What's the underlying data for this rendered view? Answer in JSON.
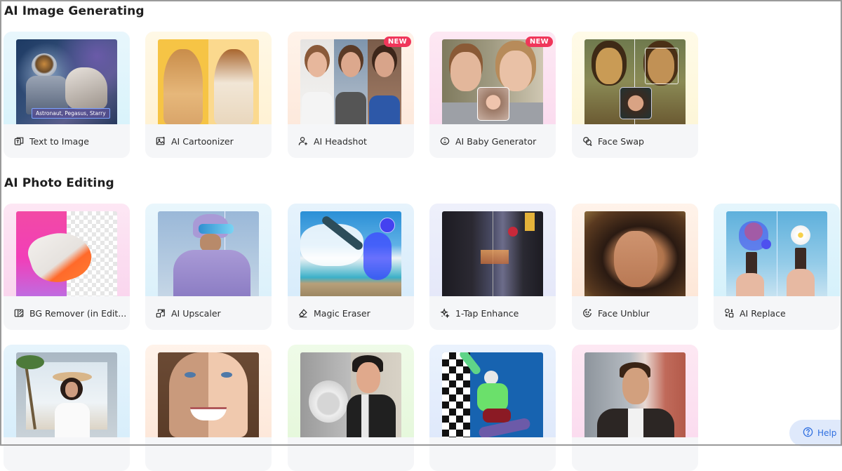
{
  "sections": [
    {
      "title": "AI Image Generating",
      "cards": [
        {
          "label": "Text to Image",
          "icon": "text-to-image-icon",
          "caption": "Astronaut, Pegasus, Starry"
        },
        {
          "label": "AI Cartoonizer",
          "icon": "image-sparkle-icon"
        },
        {
          "label": "AI Headshot",
          "icon": "user-plus-icon",
          "badge": "NEW"
        },
        {
          "label": "AI Baby Generator",
          "icon": "baby-face-icon",
          "badge": "NEW"
        },
        {
          "label": "Face Swap",
          "icon": "face-swap-icon"
        }
      ]
    },
    {
      "title": "AI Photo Editing",
      "cards": [
        {
          "label": "BG Remover (in Edit...",
          "icon": "bg-remover-icon"
        },
        {
          "label": "AI Upscaler",
          "icon": "upscale-icon"
        },
        {
          "label": "Magic Eraser",
          "icon": "eraser-icon"
        },
        {
          "label": "1-Tap Enhance",
          "icon": "enhance-sparkle-icon"
        },
        {
          "label": "Face Unblur",
          "icon": "smile-face-icon"
        },
        {
          "label": "AI Replace",
          "icon": "replace-icon"
        }
      ],
      "more_cards": [
        {
          "thumb": "beach-portrait-expand"
        },
        {
          "thumb": "face-retouch-split"
        },
        {
          "thumb": "old-photo-colorize"
        },
        {
          "thumb": "snowboarder-cutout"
        },
        {
          "thumb": "portrait-city-background"
        }
      ]
    }
  ],
  "help": {
    "label": "Help",
    "icon": "question-circle-icon"
  },
  "colors": {
    "badge": "#f0365a",
    "label_strip": "#f5f6f8",
    "help_bg": "#dfe9fb",
    "help_text": "#2f6fe0"
  }
}
